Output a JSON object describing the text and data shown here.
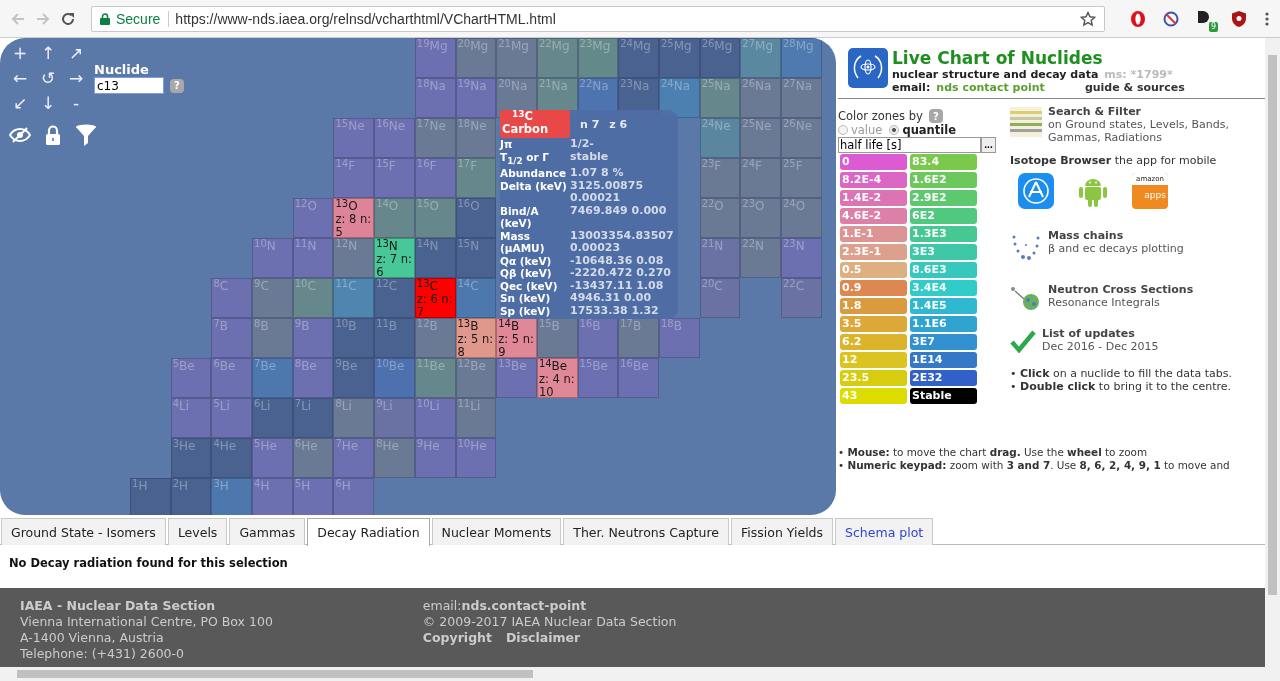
{
  "browser": {
    "secure_label": "Secure",
    "url": "https://www-nds.iaea.org/relnsd/vcharthtml/VChartHTML.html",
    "extension_badge": "9"
  },
  "navigator": {
    "pad": [
      "+",
      "↑",
      "↗",
      "←",
      "↺",
      "→",
      "↙",
      "↓",
      "-"
    ],
    "nuclide_label": "Nuclide",
    "nuclide_value": "c13",
    "help": "?"
  },
  "chart": {
    "rows": [
      {
        "cells": [
          null,
          null,
          null,
          null,
          null,
          null,
          null,
          {
            "label": "$^{19}$Mg",
            "color": "#6d70b0",
            "highlighted": false
          },
          {
            "label": "$^{20}$Mg",
            "color": "#6a7a95",
            "highlighted": false
          },
          {
            "label": "$^{21}$Mg",
            "color": "#6a7a95",
            "highlighted": false
          },
          {
            "label": "$^{22}$Mg",
            "color": "#66878c",
            "highlighted": false
          },
          {
            "label": "$^{23}$Mg",
            "color": "#64898a",
            "highlighted": false
          },
          {
            "label": "$^{24}$Mg",
            "color": "#4a6290",
            "highlighted": false
          },
          {
            "label": "$^{25}$Mg",
            "color": "#4a6290",
            "highlighted": false
          },
          {
            "label": "$^{26}$Mg",
            "color": "#4a6290",
            "highlighted": false
          },
          {
            "label": "$^{27}$Mg",
            "color": "#5a88a0",
            "highlighted": false
          },
          {
            "label": "$^{28}$Mg",
            "color": "#4e7ab0",
            "highlighted": false
          }
        ]
      },
      {
        "cells": [
          null,
          null,
          null,
          null,
          null,
          null,
          null,
          {
            "label": "$^{18}$Na",
            "color": "#6d70b0",
            "highlighted": false
          },
          {
            "label": "$^{19}$Na",
            "color": "#6d70b0",
            "highlighted": false
          },
          {
            "label": "$^{20}$Na",
            "color": "#6a7a95",
            "highlighted": false
          },
          {
            "label": "$^{21}$Na",
            "color": "#66878c",
            "highlighted": false
          },
          {
            "label": "$^{22}$Na",
            "color": "#4e74b0",
            "highlighted": false
          },
          {
            "label": "$^{23}$Na",
            "color": "#4a6290",
            "highlighted": false
          },
          {
            "label": "$^{24}$Na",
            "color": "#4b80b0",
            "highlighted": false
          },
          {
            "label": "$^{25}$Na",
            "color": "#66878c",
            "highlighted": false
          },
          {
            "label": "$^{26}$Na",
            "color": "#6a7a95",
            "highlighted": false
          },
          {
            "label": "$^{27}$Na",
            "color": "#6a7a95",
            "highlighted": false
          }
        ]
      },
      {
        "cells": [
          null,
          null,
          null,
          null,
          null,
          {
            "label": "$^{15}$Ne",
            "color": "#6d70b0",
            "highlighted": false
          },
          {
            "label": "$^{16}$Ne",
            "color": "#6d70b0",
            "highlighted": false
          },
          {
            "label": "$^{17}$Ne",
            "color": "#6a7a95",
            "highlighted": false
          },
          {
            "label": "$^{18}$Ne",
            "color": "#6a7a95",
            "highlighted": false
          },
          null,
          null,
          null,
          null,
          null,
          {
            "label": "$^{24}$Ne",
            "color": "#5a86a0",
            "highlighted": false
          },
          {
            "label": "$^{25}$Ne",
            "color": "#6a7a95",
            "highlighted": false
          },
          {
            "label": "$^{26}$Ne",
            "color": "#6a7a95",
            "highlighted": false
          }
        ]
      },
      {
        "cells": [
          null,
          null,
          null,
          null,
          null,
          {
            "label": "$^{14}$F",
            "color": "#6d70b0",
            "highlighted": false
          },
          {
            "label": "$^{15}$F",
            "color": "#6d70b0",
            "highlighted": false
          },
          {
            "label": "$^{16}$F",
            "color": "#6d70b0",
            "highlighted": false
          },
          {
            "label": "$^{17}$F",
            "color": "#66878c",
            "highlighted": false
          },
          null,
          null,
          null,
          null,
          null,
          {
            "label": "$^{23}$F",
            "color": "#6a7a95",
            "highlighted": false
          },
          {
            "label": "$^{24}$F",
            "color": "#6a7a95",
            "highlighted": false
          },
          {
            "label": "$^{25}$F",
            "color": "#6a7a95",
            "highlighted": false
          }
        ]
      },
      {
        "cells": [
          null,
          null,
          null,
          null,
          {
            "label": "$^{12}$O",
            "color": "#6d70b0",
            "highlighted": false
          },
          {
            "label": "$^{13}$O",
            "color": "#de8498",
            "highlighted": true,
            "info": "z: 8 n: 5"
          },
          {
            "label": "$^{14}$O",
            "color": "#66878c",
            "highlighted": false
          },
          {
            "label": "$^{15}$O",
            "color": "#66878c",
            "highlighted": false
          },
          {
            "label": "$^{16}$O",
            "color": "#4a6290",
            "highlighted": false
          },
          null,
          null,
          null,
          null,
          null,
          {
            "label": "$^{22}$O",
            "color": "#6a7a95",
            "highlighted": false
          },
          {
            "label": "$^{23}$O",
            "color": "#6a7a95",
            "highlighted": false
          },
          {
            "label": "$^{24}$O",
            "color": "#6a7a95",
            "highlighted": false
          }
        ]
      },
      {
        "cells": [
          null,
          null,
          null,
          {
            "label": "$^{10}$N",
            "color": "#6d70b0",
            "highlighted": false
          },
          {
            "label": "$^{11}$N",
            "color": "#6d70b0",
            "highlighted": false
          },
          {
            "label": "$^{12}$N",
            "color": "#6a7a95",
            "highlighted": false
          },
          {
            "label": "$^{13}$N",
            "color": "#48c898",
            "highlighted": true,
            "info": "z: 7 n: 6"
          },
          {
            "label": "$^{14}$N",
            "color": "#4a6290",
            "highlighted": false
          },
          {
            "label": "$^{15}$N",
            "color": "#4a6290",
            "highlighted": false
          },
          null,
          null,
          null,
          null,
          null,
          {
            "label": "$^{21}$N",
            "color": "#6a72a4",
            "highlighted": false
          },
          {
            "label": "$^{22}$N",
            "color": "#6a7a95",
            "highlighted": false
          },
          {
            "label": "$^{23}$N",
            "color": "#6d70b0",
            "highlighted": false
          }
        ]
      },
      {
        "cells": [
          null,
          null,
          {
            "label": "$^{8}$C",
            "color": "#6d70b0",
            "highlighted": false
          },
          {
            "label": "$^{9}$C",
            "color": "#6a7a95",
            "highlighted": false
          },
          {
            "label": "$^{10}$C",
            "color": "#66878c",
            "highlighted": false
          },
          {
            "label": "$^{11}$C",
            "color": "#4f86b0",
            "highlighted": false
          },
          {
            "label": "$^{12}$C",
            "color": "#4a6290",
            "highlighted": false
          },
          {
            "label": "$^{13}$C",
            "color": "#ff0000",
            "highlighted": true,
            "info": "z: 6 n: 7"
          },
          {
            "label": "$^{14}$C",
            "color": "#4d78ae",
            "highlighted": false
          },
          null,
          null,
          null,
          null,
          null,
          {
            "label": "$^{20}$C",
            "color": "#6a72a4",
            "highlighted": false
          },
          null,
          {
            "label": "$^{22}$C",
            "color": "#6a72a4",
            "highlighted": false
          }
        ]
      },
      {
        "cells": [
          null,
          null,
          {
            "label": "$^{7}$B",
            "color": "#6d70b0",
            "highlighted": false
          },
          {
            "label": "$^{8}$B",
            "color": "#6a7a95",
            "highlighted": false
          },
          {
            "label": "$^{9}$B",
            "color": "#6d70b0",
            "highlighted": false
          },
          {
            "label": "$^{10}$B",
            "color": "#4a6290",
            "highlighted": false
          },
          {
            "label": "$^{11}$B",
            "color": "#4a6290",
            "highlighted": false
          },
          {
            "label": "$^{12}$B",
            "color": "#6a7a95",
            "highlighted": false
          },
          {
            "label": "$^{13}$B",
            "color": "#e0988c",
            "highlighted": true,
            "info": "z: 5 n: 8"
          },
          {
            "label": "$^{14}$B",
            "color": "#e08898",
            "highlighted": true,
            "info": "z: 5 n: 9"
          },
          {
            "label": "$^{15}$B",
            "color": "#6a7a95",
            "highlighted": false
          },
          {
            "label": "$^{16}$B",
            "color": "#6d70b0",
            "highlighted": false
          },
          {
            "label": "$^{17}$B",
            "color": "#6a7a95",
            "highlighted": false
          },
          {
            "label": "$^{18}$B",
            "color": "#6d70b0",
            "highlighted": false
          }
        ]
      },
      {
        "cells": [
          null,
          {
            "label": "$^{5}$Be",
            "color": "#6d70b0",
            "highlighted": false
          },
          {
            "label": "$^{6}$Be",
            "color": "#6d70b0",
            "highlighted": false
          },
          {
            "label": "$^{7}$Be",
            "color": "#4d78ae",
            "highlighted": false
          },
          {
            "label": "$^{8}$Be",
            "color": "#6d70b0",
            "highlighted": false
          },
          {
            "label": "$^{9}$Be",
            "color": "#4a6290",
            "highlighted": false
          },
          {
            "label": "$^{10}$Be",
            "color": "#4d70ae",
            "highlighted": false
          },
          {
            "label": "$^{11}$Be",
            "color": "#66878c",
            "highlighted": false
          },
          {
            "label": "$^{12}$Be",
            "color": "#6a7a95",
            "highlighted": false
          },
          {
            "label": "$^{13}$Be",
            "color": "#6d70b0",
            "highlighted": false
          },
          {
            "label": "$^{14}$Be",
            "color": "#e08898",
            "highlighted": true,
            "info": "z: 4 n: 10"
          },
          {
            "label": "$^{15}$Be",
            "color": "#6d70b0",
            "highlighted": false
          },
          {
            "label": "$^{16}$Be",
            "color": "#6d70b0",
            "highlighted": false
          }
        ]
      },
      {
        "cells": [
          null,
          {
            "label": "$^{4}$Li",
            "color": "#6d70b0",
            "highlighted": false
          },
          {
            "label": "$^{5}$Li",
            "color": "#6d70b0",
            "highlighted": false
          },
          {
            "label": "$^{6}$Li",
            "color": "#4a6290",
            "highlighted": false
          },
          {
            "label": "$^{7}$Li",
            "color": "#4a6290",
            "highlighted": false
          },
          {
            "label": "$^{8}$Li",
            "color": "#6a7a95",
            "highlighted": false
          },
          {
            "label": "$^{9}$Li",
            "color": "#6a72a4",
            "highlighted": false
          },
          {
            "label": "$^{10}$Li",
            "color": "#6d70b0",
            "highlighted": false
          },
          {
            "label": "$^{11}$Li",
            "color": "#6a7a95",
            "highlighted": false
          }
        ]
      },
      {
        "cells": [
          null,
          {
            "label": "$^{3}$He",
            "color": "#4a6290",
            "highlighted": false
          },
          {
            "label": "$^{4}$He",
            "color": "#4a6290",
            "highlighted": false
          },
          {
            "label": "$^{5}$He",
            "color": "#6d70b0",
            "highlighted": false
          },
          {
            "label": "$^{6}$He",
            "color": "#6a7a95",
            "highlighted": false
          },
          {
            "label": "$^{7}$He",
            "color": "#6d70b0",
            "highlighted": false
          },
          {
            "label": "$^{8}$He",
            "color": "#6a7a95",
            "highlighted": false
          },
          {
            "label": "$^{9}$He",
            "color": "#6d70b0",
            "highlighted": false
          },
          {
            "label": "$^{10}$He",
            "color": "#6d70b0",
            "highlighted": false
          }
        ]
      },
      {
        "cells": [
          {
            "label": "$^{1}$H",
            "color": "#4a6290",
            "highlighted": false
          },
          {
            "label": "$^{2}$H",
            "color": "#4a6290",
            "highlighted": false
          },
          {
            "label": "$^{3}$H",
            "color": "#4d78ae",
            "highlighted": false
          },
          {
            "label": "$^{4}$H",
            "color": "#6d70b0",
            "highlighted": false
          },
          {
            "label": "$^{5}$H",
            "color": "#6d70b0",
            "highlighted": false
          },
          {
            "label": "$^{6}$H",
            "color": "#6d70b0",
            "highlighted": false
          }
        ]
      }
    ]
  },
  "tooltip": {
    "mass": "13",
    "symbol": "C",
    "name": "Carbon",
    "n": "n 7",
    "z": "z 6",
    "rows": [
      {
        "label": "Jπ",
        "value": "1/2-"
      },
      {
        "label": "T$_{1/2}$ or Γ",
        "value": "stable"
      },
      {
        "label": "Abundance",
        "value": "1.07 8 %"
      },
      {
        "label": "Delta (keV)",
        "value": "3125.00875 0.00021"
      },
      {
        "label": "Bind/A (keV)",
        "value": "7469.849 0.000"
      },
      {
        "label": "Mass (μAMU)",
        "value": "13003354.83507 0.00023"
      },
      {
        "label": "Qα (keV)",
        "value": "-10648.36 0.08"
      },
      {
        "label": "Qβ (keV)",
        "value": "-2220.472 0.270"
      },
      {
        "label": "Qec (keV)",
        "value": "-13437.11 1.08"
      },
      {
        "label": "Sn (keV)",
        "value": "4946.31 0.00"
      },
      {
        "label": "Sp (keV)",
        "value": "17533.38 1.32"
      }
    ]
  },
  "panel": {
    "title": "Live Chart of Nuclides",
    "subtitle": "nuclear structure and decay data",
    "ms": "ms: *1799*",
    "email_label": "email:",
    "email_link": "nds contact point",
    "guide": "guide & sources",
    "color_zones": {
      "label": "Color zones by",
      "help": "?",
      "options": [
        {
          "label": "value",
          "selected": false
        },
        {
          "label": "quantile",
          "selected": true
        }
      ],
      "quantity": "half life [s]",
      "more": "...",
      "legend": [
        {
          "items": [
            {
              "label": "0",
              "color": "#dc5ad2"
            },
            {
              "label": "8.2E-4",
              "color": "#dc66c4"
            },
            {
              "label": "1.4E-2",
              "color": "#dc74b4"
            },
            {
              "label": "4.6E-2",
              "color": "#dc80a8"
            },
            {
              "label": "1.E-1",
              "color": "#dc9494"
            },
            {
              "label": "2.3E-1",
              "color": "#dca08c"
            },
            {
              "label": "0.5",
              "color": "#dcb080"
            },
            {
              "label": "0.9",
              "color": "#dc8850"
            },
            {
              "label": "1.8",
              "color": "#dc9a40"
            },
            {
              "label": "3.5",
              "color": "#dca838"
            },
            {
              "label": "6.2",
              "color": "#dcb42c"
            },
            {
              "label": "12",
              "color": "#dcc420"
            },
            {
              "label": "23.5",
              "color": "#d8cc10"
            },
            {
              "label": "43",
              "color": "#dcdc00"
            }
          ]
        },
        {
          "items": [
            {
              "label": "83.4",
              "color": "#7ac84c"
            },
            {
              "label": "1.6E2",
              "color": "#6cc85c"
            },
            {
              "label": "2.9E2",
              "color": "#5ec86e"
            },
            {
              "label": "6E2",
              "color": "#50c880"
            },
            {
              "label": "1.3E3",
              "color": "#46c892"
            },
            {
              "label": "3E3",
              "color": "#3ec8a8"
            },
            {
              "label": "8.6E3",
              "color": "#36c8bc"
            },
            {
              "label": "3.4E4",
              "color": "#30ccc8"
            },
            {
              "label": "1.4E5",
              "color": "#30b8d0"
            },
            {
              "label": "1.1E6",
              "color": "#30a4d0"
            },
            {
              "label": "3E7",
              "color": "#3090d0"
            },
            {
              "label": "1E14",
              "color": "#3478c8"
            },
            {
              "label": "2E32",
              "color": "#3060c8"
            },
            {
              "label": "Stable",
              "color": "#000000"
            }
          ]
        }
      ]
    },
    "features": [
      {
        "kind": "search",
        "title": "Search & Filter",
        "text": "on Ground states, Levels, Bands, Gammas, Radiations"
      },
      {
        "kind": "apps",
        "title": "**Isotope Browser** the app for mobile",
        "apps": [
          {
            "kind": "appstore"
          },
          {
            "kind": "android"
          },
          {
            "kind": "amazon",
            "brand": "amazon",
            "caption": "apps"
          }
        ]
      },
      {
        "kind": "mass",
        "title": "Mass chains",
        "text": "β and ec decays plotting"
      },
      {
        "kind": "neutron",
        "title": "Neutron Cross Sections",
        "text": "Resonance Integrals"
      },
      {
        "kind": "updates",
        "title": "List of updates",
        "text": "Dec 2016 - Dec 2015"
      }
    ],
    "hints": [
      "• **Click** on a nuclide to fill the data tabs.",
      "• **Double click** to bring it to the centre."
    ],
    "keyboard_hints": [
      "• **Mouse:** to move the chart **drag.** Use the **wheel** to zoom",
      "• **Numeric keypad:** zoom with **3 and 7**. Use **8, 6, 2, 4, 9, 1** to move and"
    ]
  },
  "tabs": [
    {
      "label": "Ground State - Isomers",
      "selected": false,
      "kind": "tab"
    },
    {
      "label": "Levels",
      "selected": false,
      "kind": "tab"
    },
    {
      "label": "Gammas",
      "selected": false,
      "kind": "tab"
    },
    {
      "label": "Decay Radiation",
      "selected": true,
      "kind": "tab"
    },
    {
      "label": "Nuclear Moments",
      "selected": false,
      "kind": "tab"
    },
    {
      "label": "Ther. Neutrons Capture",
      "selected": false,
      "kind": "tab"
    },
    {
      "label": "Fission Yields",
      "selected": false,
      "kind": "tab"
    },
    {
      "label": "Schema plot",
      "selected": false,
      "kind": "link"
    }
  ],
  "message": "No Decay radiation found for this selection",
  "footer": {
    "lines": [
      "IAEA - Nuclear Data Section",
      "Vienna International Centre, PO Box 100",
      "A-1400 Vienna, Austria",
      "Telephone: (+431) 2600-0"
    ],
    "email": "email:**nds.contact-point**",
    "copyright": "© 2009-2017 IAEA Nuclear Data Section",
    "links": [
      "Copyright",
      "Disclaimer"
    ]
  }
}
